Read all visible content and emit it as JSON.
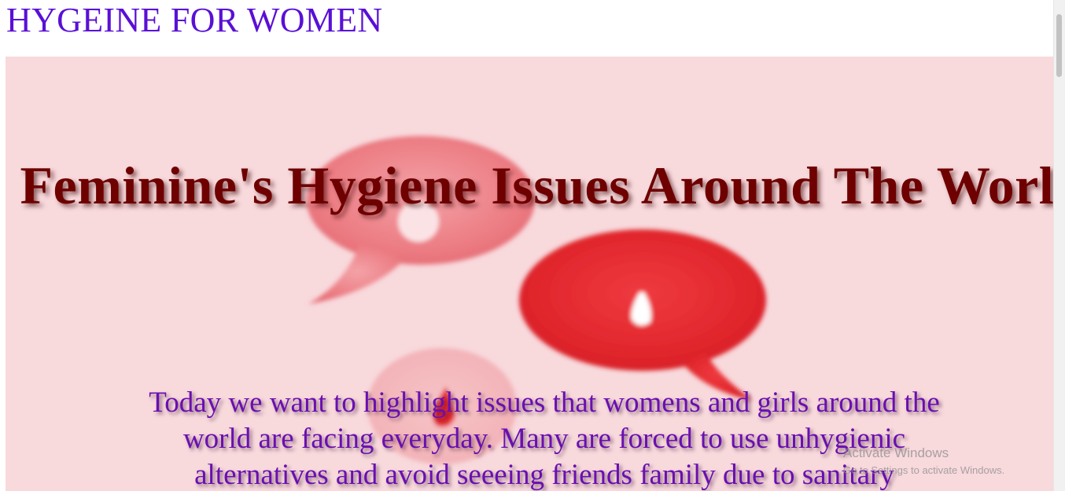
{
  "site": {
    "title": "HYGEINE FOR WOMEN"
  },
  "hero": {
    "heading": "Feminine's Hygiene Issues Around The World",
    "body": "Today we want to highlight issues that womens and girls around the world are facing everyday. Many are forced to use unhygienic alternatives and avoid seeeing friends family due to sanitary",
    "image_icons": [
      "speech-bubble-icon",
      "blood-drop-icon"
    ],
    "colors": {
      "background": "#f8d9dc",
      "heading": "#6e0000",
      "body": "#6a0fb0",
      "bubble_light": "#f0888e",
      "bubble_red": "#e3282e"
    }
  },
  "overlay": {
    "activate_title": "Activate Windows",
    "activate_hint": "Go to Settings to activate Windows."
  },
  "colors": {
    "title": "#5a0fd6"
  }
}
